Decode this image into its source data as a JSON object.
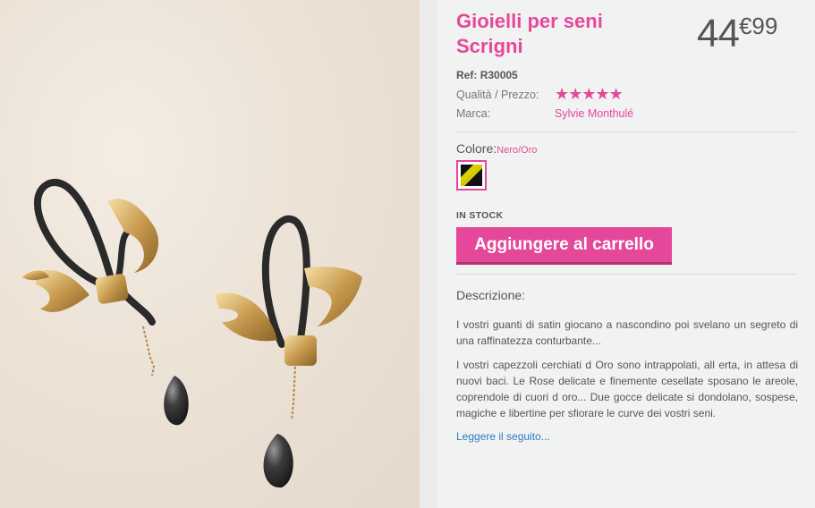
{
  "product": {
    "title": "Gioielli per seni Scrigni",
    "price_int": "44",
    "price_dec": "€99",
    "ref_label": "Ref:",
    "ref_value": "R30005",
    "quality_label": "Qualità / Prezzo:",
    "rating": 5,
    "rating_stars": "★★★★★",
    "brand_label": "Marca:",
    "brand_value": "Sylvie Monthulé",
    "color_label": "Colore:",
    "color_value": "Nero/Oro",
    "stock": "IN STOCK",
    "cart_button": "Aggiungere al carrello",
    "description_title": "Descrizione:",
    "description_p1": "I vostri guanti di satin giocano a nascondino poi svelano un segreto di una raffinatezza conturbante...",
    "description_p2": "I vostri capezzoli cerchiati d Oro sono intrappolati, all erta, in attesa di nuovi baci. Le Rose delicate e finemente cesellate sposano le areole, coprendole di cuori d oro... Due gocce delicate si dondolano, sospese, magiche e libertine per sfiorare le curve dei vostri seni.",
    "read_more": "Leggere il seguito..."
  },
  "colors": {
    "accent": "#e5489a",
    "link": "#2e7bc4",
    "swatch_primary": "#111111",
    "swatch_secondary": "#d8d000"
  },
  "image": {
    "subject": "product-photo-nipple-jewelry"
  }
}
